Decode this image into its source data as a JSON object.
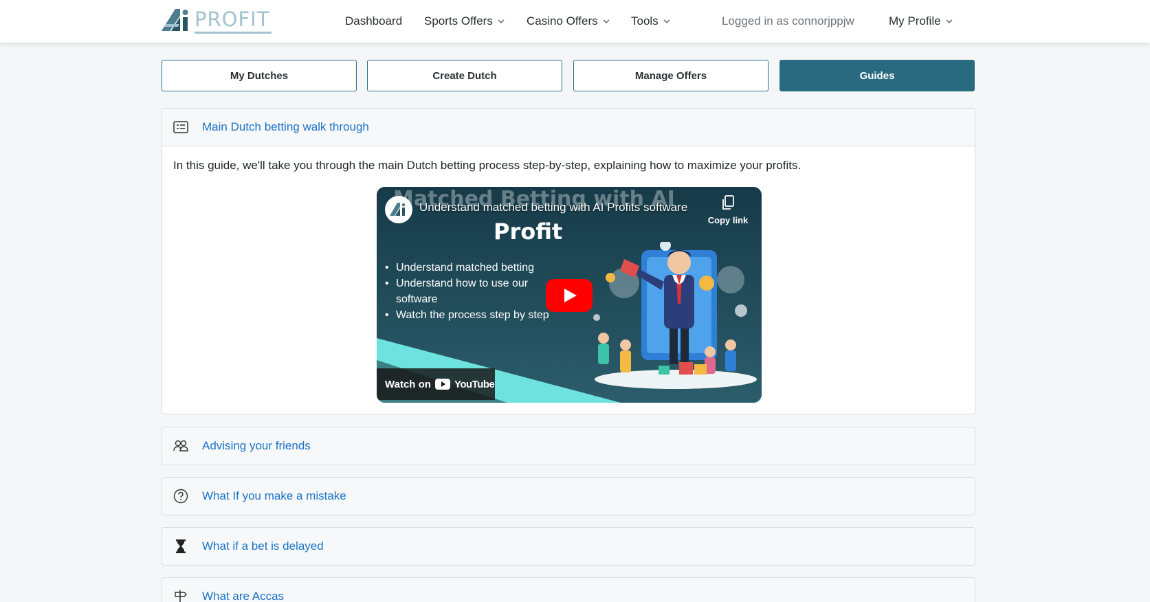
{
  "brand": {
    "logo_text": "PROFIT"
  },
  "nav": {
    "dashboard": "Dashboard",
    "sports_offers": "Sports Offers",
    "casino_offers": "Casino Offers",
    "tools": "Tools",
    "logged_in": "Logged in as connorjppjw",
    "my_profile": "My Profile"
  },
  "tabs": {
    "my_dutches": "My Dutches",
    "create_dutch": "Create Dutch",
    "manage_offers": "Manage Offers",
    "guides": "Guides"
  },
  "guides": {
    "main": {
      "title": "Main Dutch betting walk through",
      "description": "In this guide, we'll take you through the main Dutch betting process step-by-step, explaining how to maximize your profits.",
      "icon": "checklist-icon",
      "video": {
        "ghost_title": "Matched Betting with AI",
        "title": "Understand matched betting with AI Profits software",
        "copy_link": "Copy link",
        "heading": "Profit",
        "bullets": [
          "Understand matched betting",
          "Understand how to use our software",
          "Watch the process step by step"
        ],
        "watch_on": "Watch on",
        "youtube": "YouTube"
      }
    },
    "items": [
      {
        "title": "Advising your friends",
        "icon": "people-icon"
      },
      {
        "title": "What If you make a mistake",
        "icon": "question-circle-icon"
      },
      {
        "title": "What if a bet is delayed",
        "icon": "hourglass-icon"
      },
      {
        "title": "What are Accas",
        "icon": "signpost-icon"
      }
    ]
  },
  "colors": {
    "accent": "#2a6a80",
    "link": "#1a73c8",
    "youtube_red": "#ff0000"
  }
}
